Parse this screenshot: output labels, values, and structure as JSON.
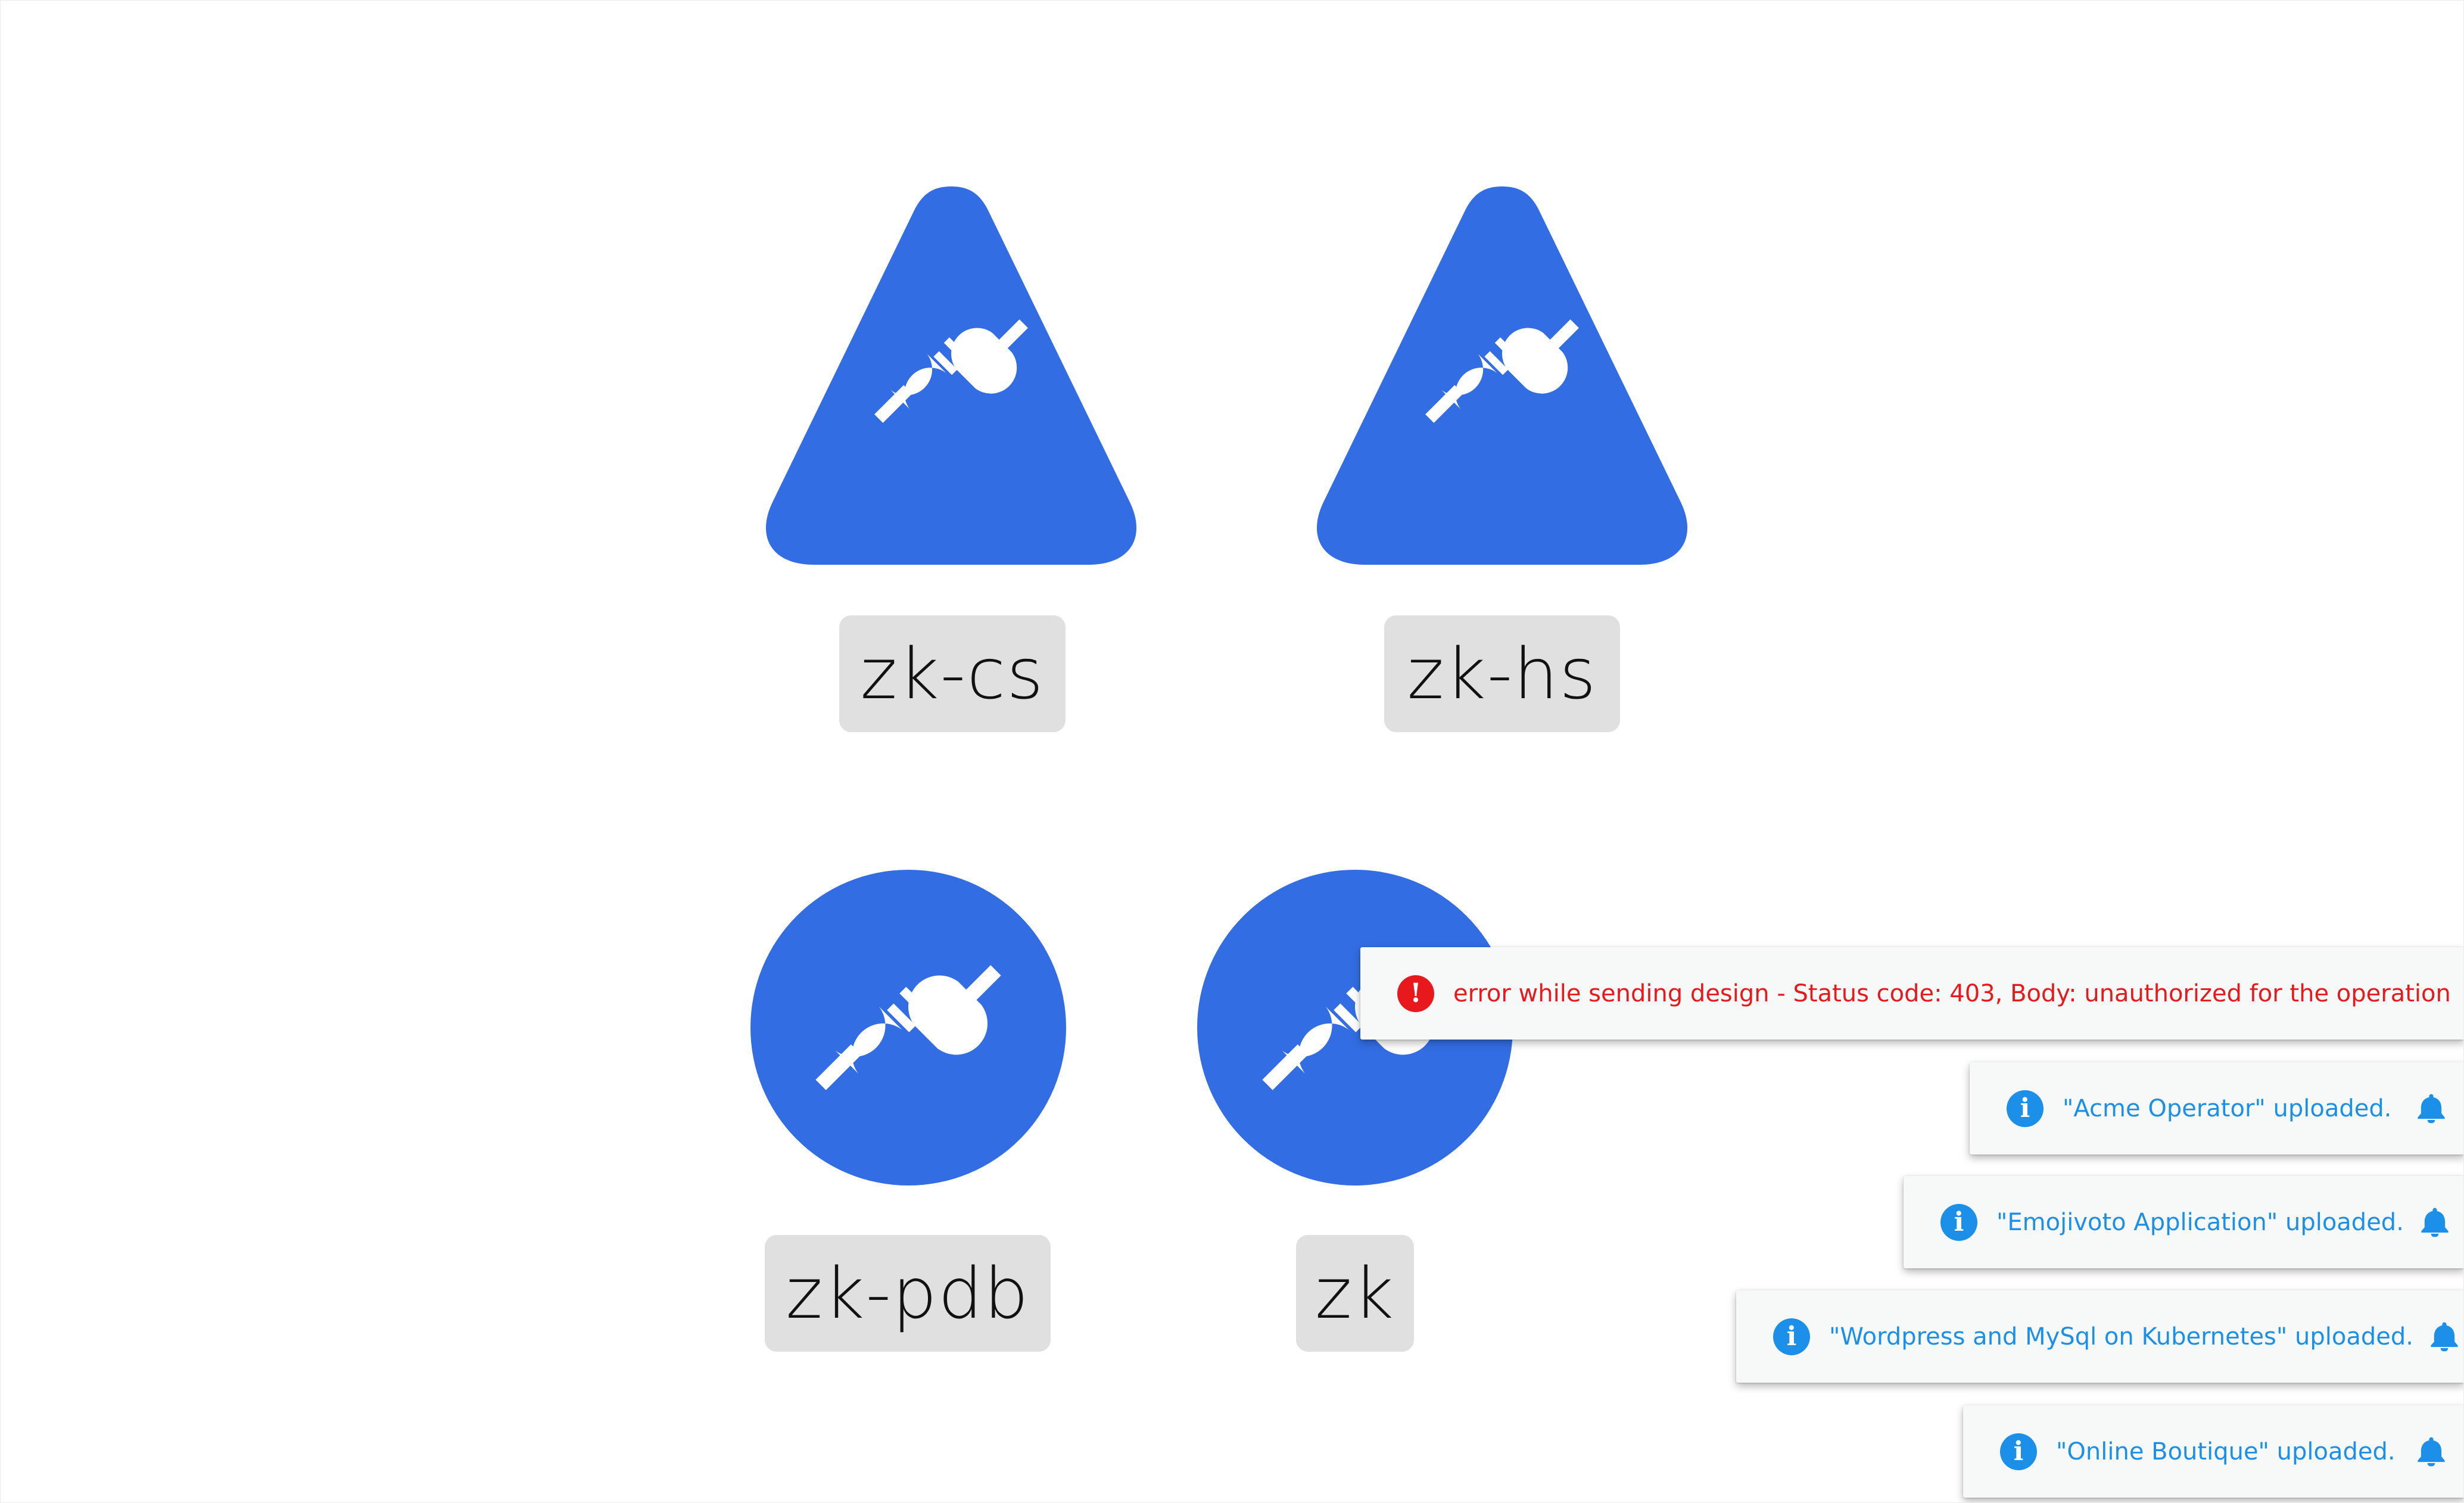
{
  "colors": {
    "node_fill": "#336de3",
    "label_background": "#e0e0e0",
    "error": "#e8191c",
    "info": "#1c8fe8",
    "toast_background": "#f7f9f8"
  },
  "nodes": [
    {
      "name": "zk-cs",
      "shape": "triangle",
      "icon": "plug-disconnect-icon"
    },
    {
      "name": "zk-hs",
      "shape": "triangle",
      "icon": "plug-disconnect-icon"
    },
    {
      "name": "zk-pdb",
      "shape": "circle",
      "icon": "plug-disconnect-icon"
    },
    {
      "name": "zk",
      "shape": "circle",
      "icon": "plug-disconnect-icon"
    }
  ],
  "notifications": [
    {
      "type": "error",
      "icon": "exclamation-circle-icon",
      "message": "error while sending design - Status code: 403, Body: unauthorized for the operation",
      "action_icon": "bell-icon"
    },
    {
      "type": "info",
      "icon": "info-circle-icon",
      "message": "\"Acme Operator\" uploaded.",
      "action_icon": "bell-icon"
    },
    {
      "type": "info",
      "icon": "info-circle-icon",
      "message": "\"Emojivoto Application\" uploaded.",
      "action_icon": "bell-icon"
    },
    {
      "type": "info",
      "icon": "info-circle-icon",
      "message": "\"Wordpress and MySql on Kubernetes\" uploaded.",
      "action_icon": "bell-icon"
    },
    {
      "type": "info",
      "icon": "info-circle-icon",
      "message": "\"Online Boutique\" uploaded.",
      "action_icon": "bell-icon"
    }
  ]
}
